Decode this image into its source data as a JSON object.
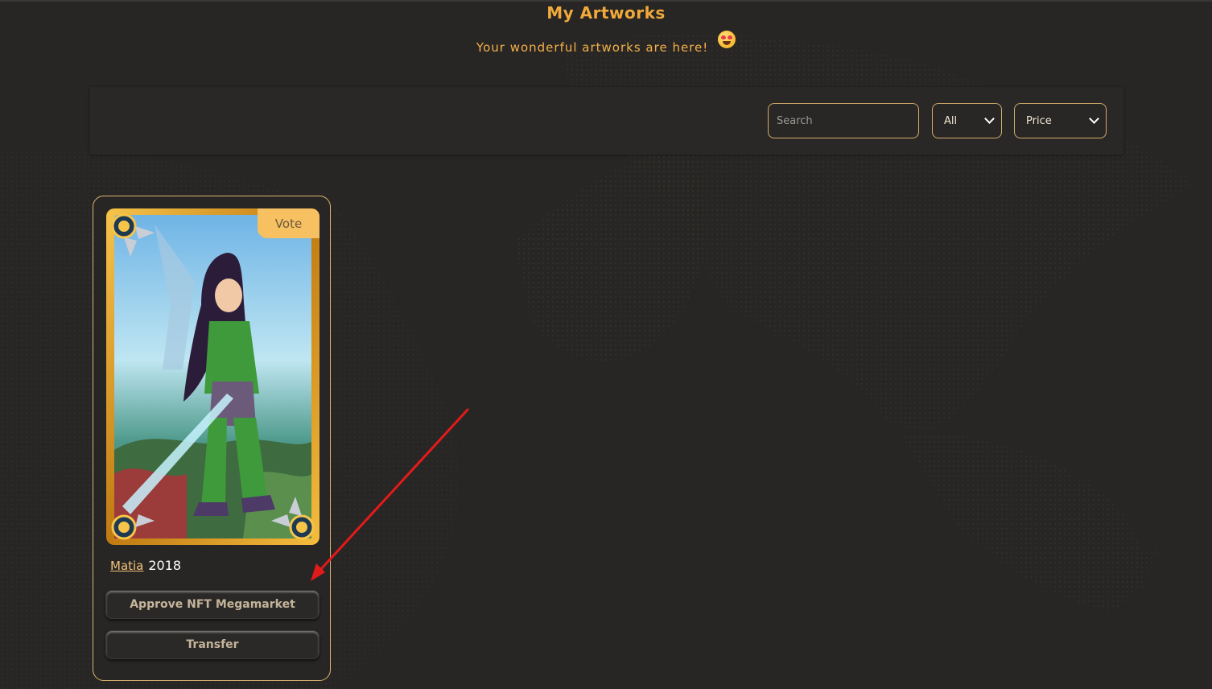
{
  "header": {
    "title": "My Artworks",
    "subtitle": "Your wonderful artworks are here!",
    "subtitle_emoji": "heart-eyes-emoji"
  },
  "filters": {
    "search_placeholder": "Search",
    "search_value": "",
    "type_selected": "All",
    "sort_selected": "Price"
  },
  "cards": [
    {
      "vote_label": "Vote",
      "owner": "Matia",
      "year": "2018",
      "approve_label": "Approve NFT Megamarket",
      "transfer_label": "Transfer"
    }
  ],
  "colors": {
    "background": "#282624",
    "accent": "#f0a93a",
    "card_border": "#d9b36e",
    "vote_badge": "#f7c061",
    "annotation_arrow": "#e31a1a"
  },
  "annotation": {
    "type": "arrow",
    "points_to": "approve-nft-megamarket-button"
  }
}
